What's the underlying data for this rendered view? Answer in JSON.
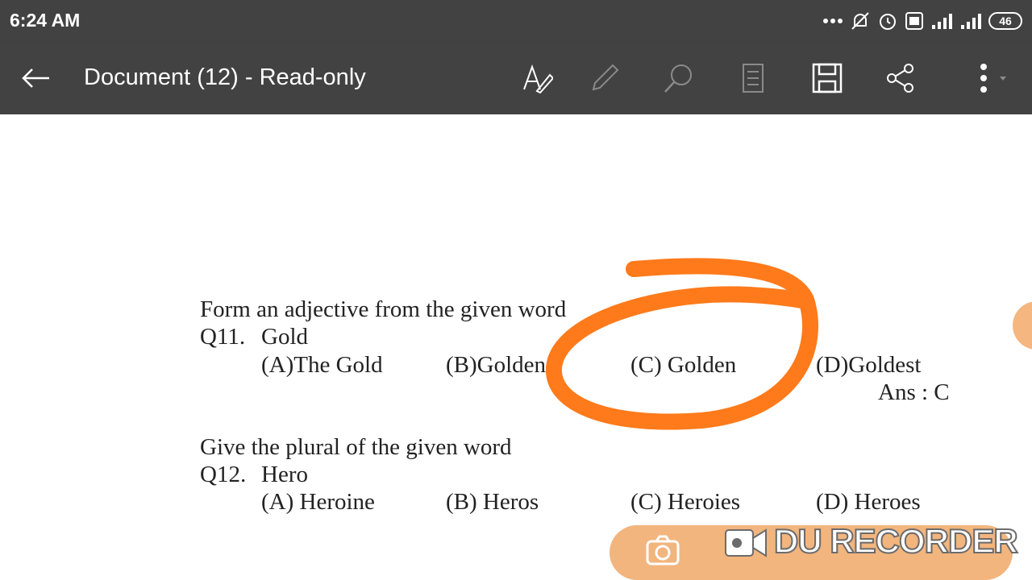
{
  "status_bar": {
    "time": "6:24 AM",
    "battery": "46"
  },
  "toolbar": {
    "title": "Document (12) - Read-only"
  },
  "document": {
    "section1_instruction": "Form an adjective from the given word",
    "q11": {
      "number": "Q11.",
      "word": "Gold",
      "options": [
        "(A)The Gold",
        "(B)Golden",
        "(C) Golden",
        "(D)Goldest"
      ],
      "answer": "Ans : C"
    },
    "section2_instruction": "Give the plural of the given word",
    "q12": {
      "number": "Q12.",
      "word": "Hero",
      "options": [
        "(A) Heroine",
        "(B) Heros",
        "(C) Heroies",
        "(D) Heroes"
      ]
    }
  },
  "recorder": {
    "watermark": "DU RECORDER"
  },
  "colors": {
    "toolbar": "#424242",
    "annotation": "#ff7a1a",
    "recorder": "#f2b57e"
  }
}
